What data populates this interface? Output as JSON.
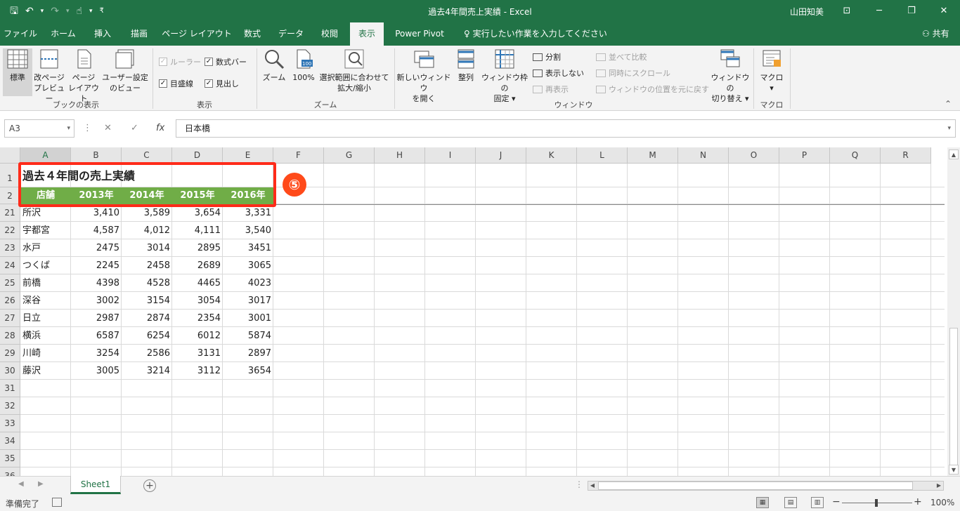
{
  "window": {
    "title": "過去4年間売上実績  -  Excel",
    "user": "山田知美",
    "minimize": "─",
    "restore": "❐",
    "close": "✕",
    "ribbon_display": "⊡"
  },
  "qat": {
    "save": "🖫",
    "undo": "↶",
    "undo_dd": "▾",
    "redo": "↷",
    "redo_dd": "▾",
    "touch": "☝",
    "touch_dd": "▾",
    "customize": "₹"
  },
  "tabs": [
    "ファイル",
    "ホーム",
    "挿入",
    "描画",
    "ページ レイアウト",
    "数式",
    "データ",
    "校閲",
    "表示",
    "Power Pivot"
  ],
  "active_tab": "表示",
  "tell_me": "実行したい作業を入力してください",
  "share": "共有",
  "ribbon": {
    "workbook_views": {
      "label": "ブックの表示",
      "normal": "標準",
      "page_break_1": "改ページ",
      "page_break_2": "プレビュー",
      "page_layout_1": "ページ",
      "page_layout_2": "レイアウト",
      "custom_1": "ユーザー設定",
      "custom_2": "のビュー"
    },
    "show": {
      "label": "表示",
      "ruler": "ルーラー",
      "formula_bar": "数式バー",
      "gridlines": "目盛線",
      "headings": "見出し"
    },
    "zoom": {
      "label": "ズーム",
      "zoom": "ズーム",
      "pct100": "100%",
      "sel_1": "選択範囲に合わせて",
      "sel_2": "拡大/縮小"
    },
    "window": {
      "label": "ウィンドウ",
      "new_1": "新しいウィンドウ",
      "new_2": "を開く",
      "arrange": "整列",
      "freeze_1": "ウィンドウ枠の",
      "freeze_2": "固定 ▾",
      "split": "分割",
      "hide": "表示しない",
      "unhide": "再表示",
      "side_by_side": "並べて比較",
      "sync_scroll": "同時にスクロール",
      "reset_pos": "ウィンドウの位置を元に戻す",
      "switch_1": "ウィンドウの",
      "switch_2": "切り替え ▾"
    },
    "macros": {
      "label": "マクロ",
      "macro": "マクロ",
      "dd": "▾"
    },
    "collapse": "⌃"
  },
  "formula_bar": {
    "name_box": "A3",
    "dd": "▾",
    "cancel": "✕",
    "enter": "✓",
    "fx": "fx",
    "sep": "⋮",
    "value": "日本橋",
    "expand": "▾"
  },
  "grid": {
    "columns": [
      "A",
      "B",
      "C",
      "D",
      "E",
      "F",
      "G",
      "H",
      "I",
      "J",
      "K",
      "L",
      "M",
      "N",
      "O",
      "P",
      "Q",
      "R"
    ],
    "row_numbers": [
      "1",
      "2",
      "21",
      "22",
      "23",
      "24",
      "25",
      "26",
      "27",
      "28",
      "29",
      "30",
      "31",
      "32",
      "33",
      "34",
      "35",
      "36"
    ],
    "title": "過去４年間の売上実績",
    "headers": [
      "店舗",
      "2013年",
      "2014年",
      "2015年",
      "2016年"
    ],
    "rows": [
      {
        "store": "所沢",
        "values": [
          "3,410",
          "3,589",
          "3,654",
          "3,331"
        ]
      },
      {
        "store": "宇都宮",
        "values": [
          "4,587",
          "4,012",
          "4,111",
          "3,540"
        ]
      },
      {
        "store": "水戸",
        "values": [
          "2475",
          "3014",
          "2895",
          "3451"
        ]
      },
      {
        "store": "つくば",
        "values": [
          "2245",
          "2458",
          "2689",
          "3065"
        ]
      },
      {
        "store": "前橋",
        "values": [
          "4398",
          "4528",
          "4465",
          "4023"
        ]
      },
      {
        "store": "深谷",
        "values": [
          "3002",
          "3154",
          "3054",
          "3017"
        ]
      },
      {
        "store": "日立",
        "values": [
          "2987",
          "2874",
          "2354",
          "3001"
        ]
      },
      {
        "store": "横浜",
        "values": [
          "6587",
          "6254",
          "6012",
          "5874"
        ]
      },
      {
        "store": "川崎",
        "values": [
          "3254",
          "2586",
          "3131",
          "2897"
        ]
      },
      {
        "store": "藤沢",
        "values": [
          "3005",
          "3214",
          "3112",
          "3654"
        ]
      }
    ],
    "annotation": "⑤",
    "scroll_up": "▲",
    "scroll_down": "▼"
  },
  "sheets": {
    "tabs": [
      "Sheet1"
    ],
    "add": "+",
    "prev": "◀",
    "next": "▶",
    "left": "◀",
    "right": "▶",
    "sep": "⋮"
  },
  "status": {
    "ready": "準備完了",
    "view_normal": "▦",
    "view_layout": "▤",
    "view_break": "▥",
    "zoom_out": "−",
    "zoom_in": "+",
    "zoom": "100%"
  },
  "colors": {
    "excel_green": "#217346",
    "header_fill": "#70ad47",
    "highlight": "#ff2b1a"
  }
}
